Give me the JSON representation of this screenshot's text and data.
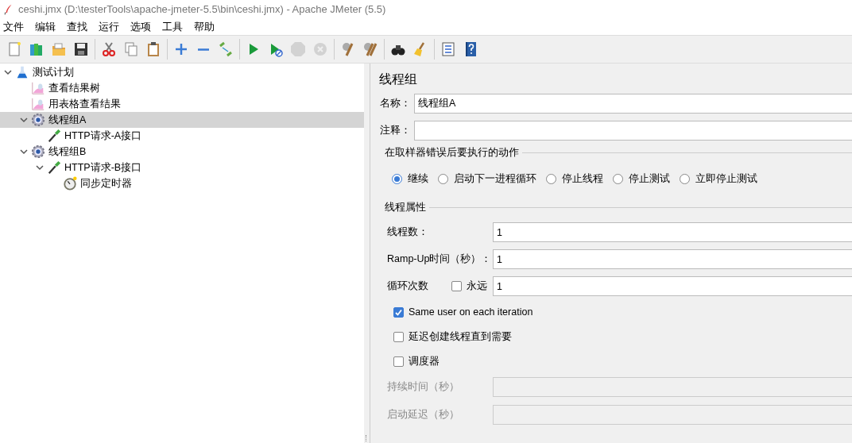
{
  "window": {
    "title": "ceshi.jmx (D:\\testerTools\\apache-jmeter-5.5\\bin\\ceshi.jmx) - Apache JMeter (5.5)"
  },
  "menu": [
    "文件",
    "编辑",
    "查找",
    "运行",
    "选项",
    "工具",
    "帮助"
  ],
  "toolbar": [
    {
      "disabled": false
    },
    {
      "disabled": false
    },
    {
      "disabled": false
    },
    {
      "disabled": false
    },
    {
      "disabled": false
    },
    {
      "disabled": false
    },
    {
      "disabled": false
    },
    {
      "disabled": false
    },
    {
      "disabled": false
    },
    {
      "disabled": false
    },
    {
      "disabled": false
    },
    {
      "disabled": false
    },
    {
      "disabled": true
    },
    {
      "disabled": true
    },
    {
      "disabled": false
    },
    {
      "disabled": false
    },
    {
      "disabled": false
    },
    {
      "disabled": false
    },
    {
      "disabled": false
    },
    {
      "disabled": false
    }
  ],
  "tree": [
    {
      "label": "测试计划",
      "kind": "plan",
      "expanded": true,
      "selected": false,
      "children": [
        {
          "label": "查看结果树",
          "kind": "listener",
          "selected": false
        },
        {
          "label": "用表格查看结果",
          "kind": "listener",
          "selected": false
        },
        {
          "label": "线程组A",
          "kind": "thread-group",
          "expanded": true,
          "selected": true,
          "children": [
            {
              "label": "HTTP请求-A接口",
              "kind": "sampler",
              "selected": false
            }
          ]
        },
        {
          "label": "线程组B",
          "kind": "thread-group",
          "expanded": true,
          "selected": false,
          "children": [
            {
              "label": "HTTP请求-B接口",
              "kind": "sampler",
              "expanded": true,
              "selected": false,
              "children": [
                {
                  "label": "同步定时器",
                  "kind": "timer",
                  "selected": false
                }
              ]
            }
          ]
        }
      ]
    }
  ],
  "panel": {
    "title": "线程组",
    "name": {
      "label": "名称：",
      "value": "线程组A"
    },
    "comment": {
      "label": "注释："
    },
    "error_action": {
      "heading": "在取样器错误后要执行的动作",
      "options": [
        {
          "label": "继续",
          "selected": true
        },
        {
          "label": "启动下一进程循环",
          "selected": false
        },
        {
          "label": "停止线程",
          "selected": false
        },
        {
          "label": "停止测试",
          "selected": false
        },
        {
          "label": "立即停止测试",
          "selected": false
        }
      ]
    },
    "thread_properties": {
      "heading": "线程属性",
      "fields": [
        {
          "label": "线程数：",
          "value": "1"
        },
        {
          "label": "Ramp-Up时间（秒）：",
          "value": "1"
        }
      ],
      "loop": {
        "label": "循环次数",
        "forever": {
          "label": "永远",
          "checked": false
        },
        "value": "1"
      },
      "options": [
        {
          "label": "Same user on each iteration",
          "checked": true
        },
        {
          "label": "延迟创建线程直到需要",
          "checked": false
        },
        {
          "label": "调度器",
          "checked": false
        }
      ],
      "scheduler_fields": [
        {
          "label": "持续时间（秒）",
          "disabled": true
        },
        {
          "label": "启动延迟（秒）",
          "disabled": true
        }
      ]
    }
  }
}
